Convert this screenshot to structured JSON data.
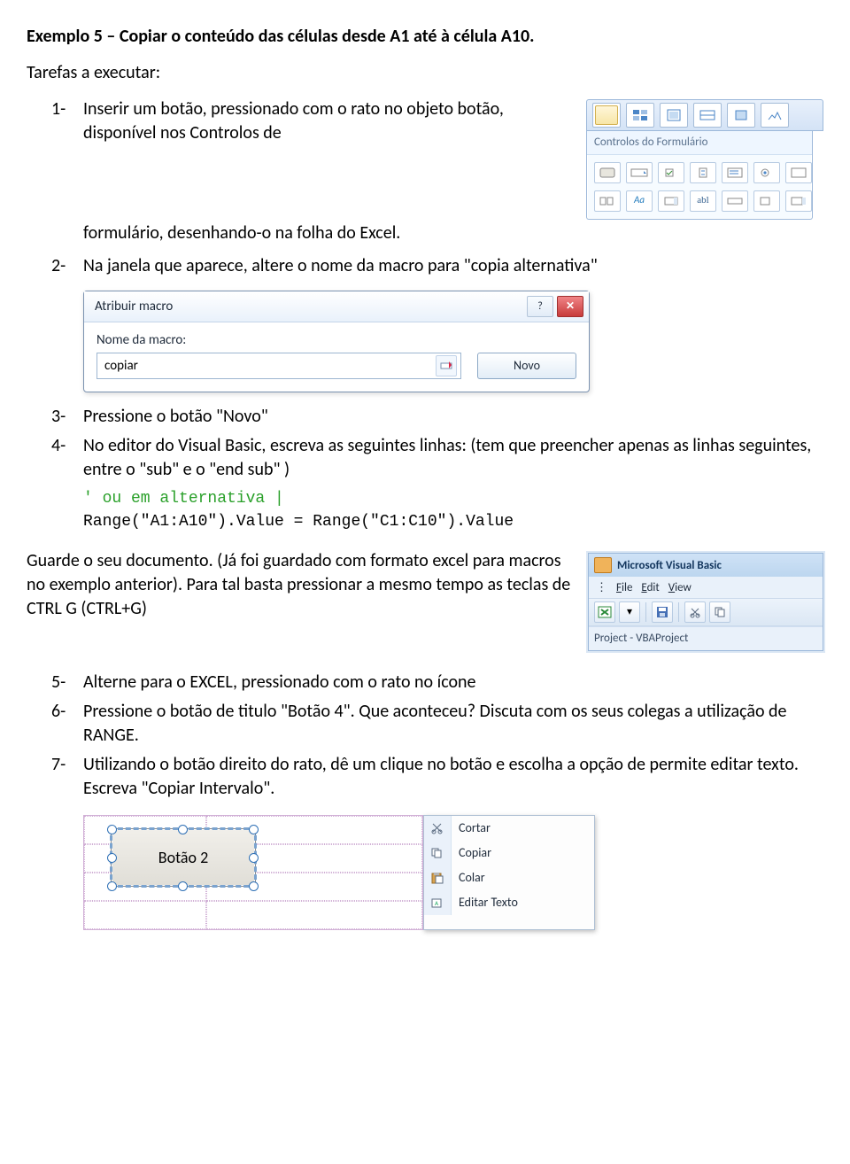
{
  "title": "Exemplo 5 – Copiar o conteúdo das células desde A1 até à célula A10.",
  "tasks_intro": "Tarefas a executar:",
  "steps": {
    "s1": "1-",
    "s1_text": "Inserir um botão, pressionado com o rato no objeto botão, disponível nos Controlos de",
    "s1b": "formulário, desenhando-o na folha do Excel.",
    "s2": "2-",
    "s2_text": "Na janela que aparece, altere o nome da macro para \"copia alternativa\"",
    "s3": "3-",
    "s3_text": "Pressione o botão \"Novo\"",
    "s4": "4-",
    "s4_text": "No editor do Visual Basic, escreva as seguintes linhas: (tem que preencher apenas as linhas seguintes, entre o \"sub\" e o \"end sub\" )",
    "savep1": "Guarde o seu documento. (Já foi guardado com formato excel para macros no exemplo anterior). Para tal basta pressionar a mesmo tempo as teclas de CTRL   G (CTRL+G)",
    "s5": "5-",
    "s5_text": "Alterne para o EXCEL, pressionado com o rato no ícone",
    "s6": "6-",
    "s6_text": "Pressione o botão de titulo \"Botão 4\". Que aconteceu? Discuta com os seus colegas a utilização de RANGE.",
    "s7": "7-",
    "s7_text": "Utilizando o botão direito do rato, dê um clique no botão e escolha a opção de permite editar texto.  Escreva \"Copiar Intervalo\"."
  },
  "gallery": {
    "title": "Controlos do Formulário",
    "row2_labels": [
      "",
      "Aa",
      "",
      "abl",
      "",
      "",
      ""
    ]
  },
  "dialog": {
    "title": "Atribuir macro",
    "label": "Nome da macro:",
    "value": "copiar",
    "novo": "Novo"
  },
  "code": {
    "comment": "' ou em alternativa ",
    "cursor": "|",
    "line": "Range(\"A1:A10\").Value = Range(\"C1:C10\").Value"
  },
  "vba": {
    "title": "Microsoft Visual Basic",
    "menu": {
      "file": "File",
      "edit": "Edit",
      "view": "View"
    },
    "project": "Project - VBAProject"
  },
  "shape_button_label": "Botão 2",
  "context_menu": {
    "cortar": "Cortar",
    "copiar": "Copiar",
    "colar": "Colar",
    "editar": "Editar Texto"
  }
}
